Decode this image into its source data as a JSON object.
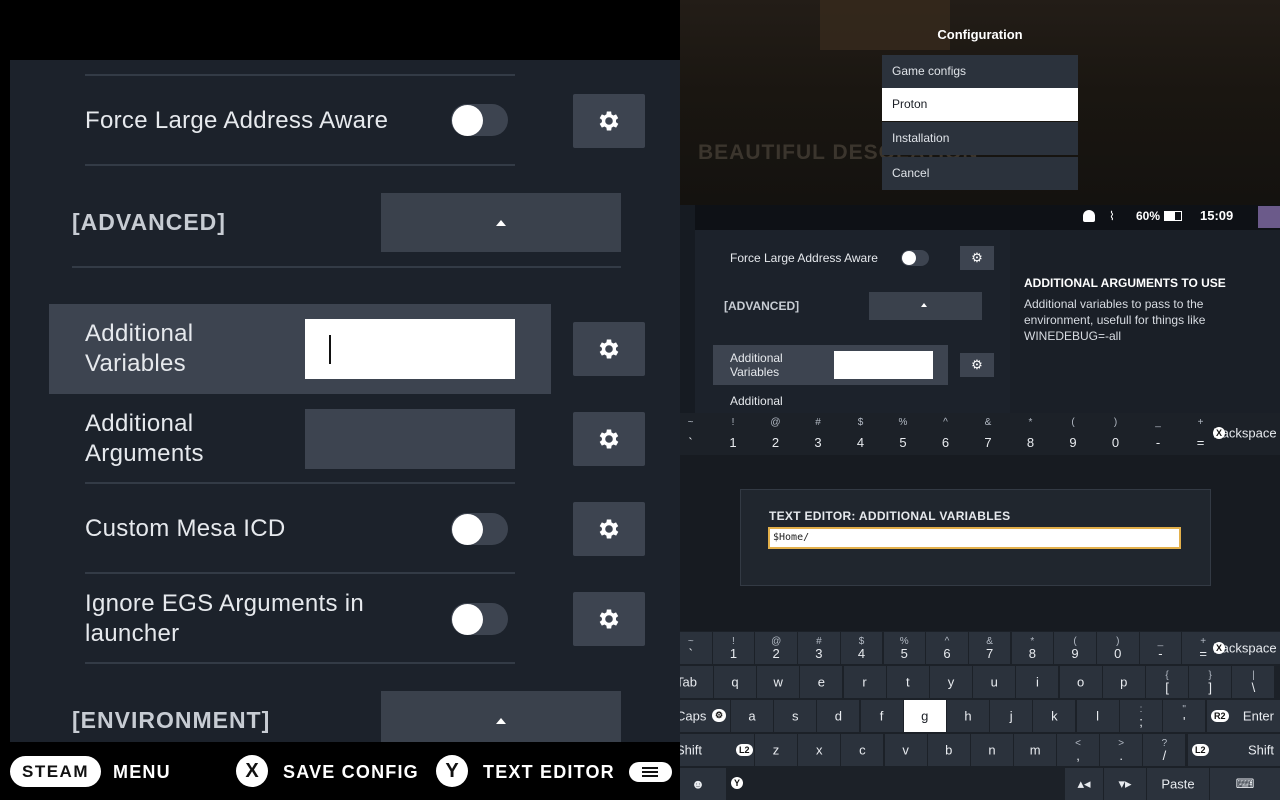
{
  "left": {
    "rows": {
      "force_laa": {
        "label": "Force Large Address Aware"
      },
      "advanced": {
        "label": "[ADVANCED]"
      },
      "add_vars": {
        "label_line1": "Additional",
        "label_line2": "Variables"
      },
      "add_args": {
        "label_line1": "Additional",
        "label_line2": "Arguments"
      },
      "mesa": {
        "label": "Custom Mesa ICD"
      },
      "egs": {
        "label_line1": "Ignore EGS Arguments in",
        "label_line2": "launcher"
      },
      "environment": {
        "label": "[ENVIRONMENT]"
      }
    },
    "footer": {
      "steam": "STEAM",
      "menu": "MENU",
      "x_glyph": "X",
      "save": "SAVE CONFIG",
      "y_glyph": "Y",
      "text_editor": "TEXT EDITOR"
    }
  },
  "right": {
    "config_menu": {
      "title": "Configuration",
      "items": [
        "Game configs",
        "Proton",
        "Installation",
        "Cancel"
      ],
      "selected": "Proton"
    },
    "bg_title": "BEAUTIFUL DESOLATION",
    "status": {
      "battery": "60%",
      "time": "15:09"
    },
    "mini": {
      "force_laa": "Force Large Address Aware",
      "advanced": "[ADVANCED]",
      "add_vars_1": "Additional",
      "add_vars_2": "Variables",
      "add_args": "Additional",
      "help_title": "ADDITIONAL ARGUMENTS TO USE",
      "help_text": "Additional variables to pass to the environment, usefull for things like WINEDEBUG=-all"
    },
    "editor": {
      "title": "TEXT EDITOR: ADDITIONAL VARIABLES",
      "value": "$Home/"
    },
    "keyboard": {
      "number_row": [
        {
          "sub": "~",
          "main": "`"
        },
        {
          "sub": "!",
          "main": "1"
        },
        {
          "sub": "@",
          "main": "2"
        },
        {
          "sub": "#",
          "main": "3"
        },
        {
          "sub": "$",
          "main": "4"
        },
        {
          "sub": "%",
          "main": "5"
        },
        {
          "sub": "^",
          "main": "6"
        },
        {
          "sub": "&",
          "main": "7"
        },
        {
          "sub": "*",
          "main": "8"
        },
        {
          "sub": "(",
          "main": "9"
        },
        {
          "sub": ")",
          "main": "0"
        },
        {
          "sub": "_",
          "main": "-"
        },
        {
          "sub": "+",
          "main": "="
        }
      ],
      "backspace": "Backspace",
      "backspace_glyph": "X",
      "tab": "Tab",
      "row_q": [
        "q",
        "w",
        "e",
        "r",
        "t",
        "y",
        "u",
        "i",
        "o",
        "p"
      ],
      "row_q_extra": [
        {
          "sub": "{",
          "main": "["
        },
        {
          "sub": "}",
          "main": "]"
        },
        {
          "sub": "|",
          "main": "\\"
        }
      ],
      "caps": "Caps",
      "row_a": [
        "a",
        "s",
        "d",
        "f",
        "g",
        "h",
        "j",
        "k",
        "l"
      ],
      "row_a_extra": [
        {
          "sub": ":",
          "main": ";"
        },
        {
          "sub": "\"",
          "main": "'"
        }
      ],
      "enter": "Enter",
      "enter_glyph": "R2",
      "shift": "Shift",
      "shift_glyph": "L2",
      "row_z": [
        "z",
        "x",
        "c",
        "v",
        "b",
        "n",
        "m"
      ],
      "row_z_extra": [
        {
          "sub": "<",
          "main": ","
        },
        {
          "sub": ">",
          "main": "."
        },
        {
          "sub": "?",
          "main": "/"
        }
      ],
      "shift_right": "Shift",
      "shift_right_glyph": "L2",
      "emoji_glyph": "☻",
      "y_glyph": "Y",
      "paste": "Paste",
      "highlighted_key": "g"
    }
  }
}
